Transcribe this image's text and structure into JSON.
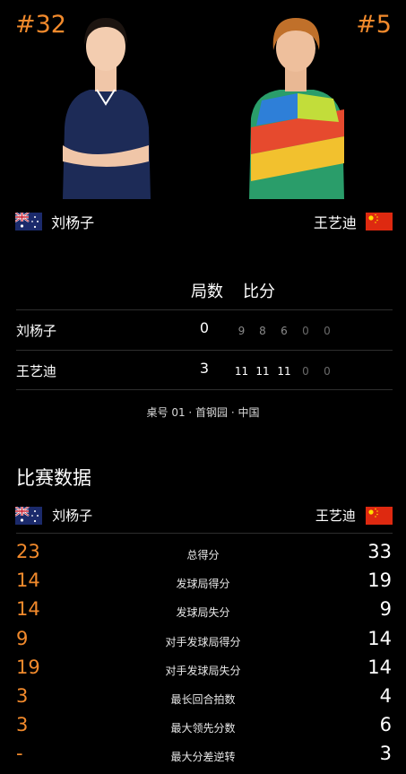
{
  "header": {
    "left_rank": "#32",
    "right_rank": "#5",
    "left_player": "刘杨子",
    "right_player": "王艺迪"
  },
  "score_table": {
    "games_label": "局数",
    "points_label": "比分",
    "rows": [
      {
        "name": "刘杨子",
        "games": "0",
        "points": [
          "9",
          "8",
          "6",
          "0",
          "0"
        ]
      },
      {
        "name": "王艺迪",
        "games": "3",
        "points": [
          "11",
          "11",
          "11",
          "0",
          "0"
        ]
      }
    ]
  },
  "venue": "桌号 01 · 首钢园 · 中国",
  "stats_section": {
    "title": "比赛数据",
    "left_player": "刘杨子",
    "right_player": "王艺迪",
    "rows": [
      {
        "left": "23",
        "label": "总得分",
        "right": "33"
      },
      {
        "left": "14",
        "label": "发球局得分",
        "right": "19"
      },
      {
        "left": "14",
        "label": "发球局失分",
        "right": "9"
      },
      {
        "left": "9",
        "label": "对手发球局得分",
        "right": "14"
      },
      {
        "left": "19",
        "label": "对手发球局失分",
        "right": "14"
      },
      {
        "left": "3",
        "label": "最长回合拍数",
        "right": "4"
      },
      {
        "left": "3",
        "label": "最大领先分数",
        "right": "6"
      },
      {
        "left": "-",
        "label": "最大分差逆转",
        "right": "3"
      }
    ]
  },
  "colors": {
    "accent": "#f28a2c",
    "background": "#000000"
  },
  "icons": {
    "left_flag": "australia-flag-icon",
    "right_flag": "china-flag-icon"
  }
}
